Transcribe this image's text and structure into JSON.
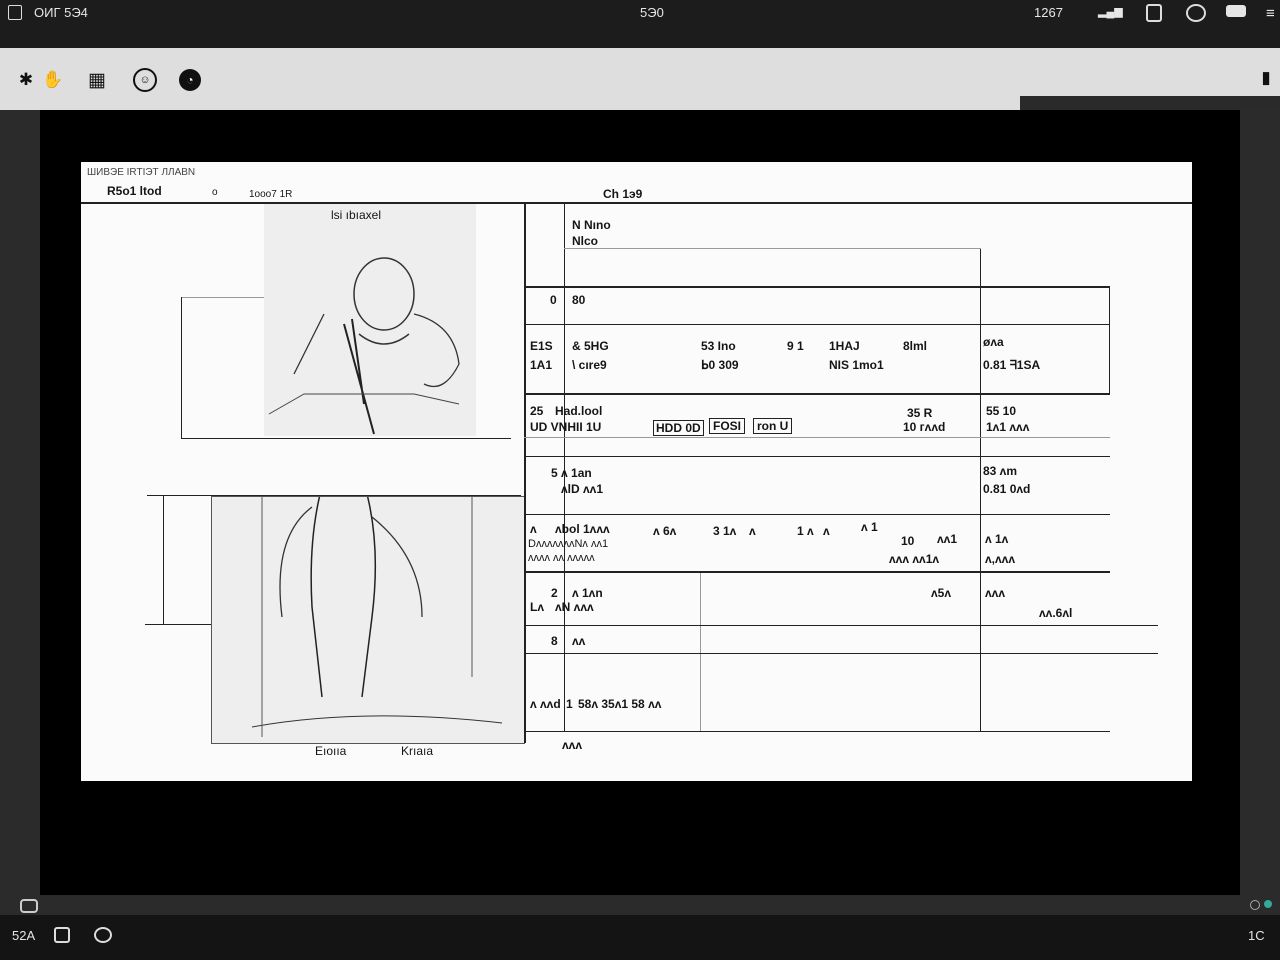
{
  "status_bar": {
    "app_label": "ОИГ 5Э4",
    "center_label": "5Э0",
    "time": "1267"
  },
  "toolbar": {
    "icons": [
      "asterisk-icon",
      "hand-icon",
      "grid-icon",
      "face-icon",
      "clock-icon",
      "book-icon"
    ]
  },
  "document": {
    "header": {
      "top_line": "ШИВЭЕ ІRTІЭТ ЛЛАВN",
      "left_label": "R5o1 ltod",
      "left_small": "o",
      "mid_small": "1ooo7 1R",
      "center_label": "Сh 1э9"
    },
    "sketch": {
      "caption_top": "lsi ıbıaxel",
      "caption_bottom_left": "Eıoııa",
      "caption_bottom_right": "Krıaıa"
    },
    "table_rows": [
      {
        "cells": [
          "N Nııo",
          "Nlco"
        ]
      },
      {
        "cells": [
          "0",
          "80"
        ]
      },
      {
        "cells": [
          "Ε1S2",
          "Ꮾ 5ΗG",
          "ᗺЗ 1ıııo",
          "ᖷ1",
          "1HAJ",
          "8lııl",
          "ølпі"
        ]
      },
      {
        "cells": [
          "1А1",
          "\\l cıreэ",
          "ᖯ0 ЗОЭ",
          "NIS 1ΓΠΟ",
          "0.Ъl ᖺlSA"
        ]
      },
      {
        "cells": [
          "2ᖷ",
          "Hadloo1",
          "UDVNHII 1U",
          "HDD 0D",
          "FOSI",
          "ᖷoıı U",
          "ᖷ3 ᖷ",
          "ᖷ1 ᖷᖷ1",
          "5ᖷ 1O",
          "1ᖷ1 ᖷ1ᖷ"
        ]
      },
      {
        "cells": [
          "5 ᖷ ᖷan",
          "ᖷID ᖷᖷᖷ",
          "8ᖷ 1ᖷᖷ",
          "0.ᖷ1 ᖷᖷᖷ"
        ]
      },
      {
        "cells": [
          "ᖷ",
          "ᖷᖷ1 1ᖷᖷᖷᖷ",
          "ᖷᖷᖷᖷᖷ",
          "5ᖷ ᖷ",
          "ᖷᖷᖷ",
          "ᖷᖷ",
          "ᖷᖷ ᖷ",
          "ᖷ1ᖷ",
          "ᖷᖷᖷᖷᖷᖷ",
          "ᖷ ᖷᖷᖷ",
          "ᖷᖷ ᖷᖷ"
        ]
      },
      {
        "cells": [
          "2",
          "ᖷ 1ᖷᖷᖷ",
          "ᖷᖷ ᖷᖷᖷᖷᖷ",
          "ᖷᖷᖷ ᖷ",
          "ᖷᖷᖷ",
          "ᖷᖷ.ᖷᖷᖷ"
        ]
      },
      {
        "cells": [
          "ᖷ",
          "ᖷᖷ"
        ]
      },
      {
        "cells": [
          "ᖷ ᖷᖷᖷ",
          "ᖷ",
          "ᖷᖷᖷ ᖷᖷᖷᖷ ᖷᖷ ᖷᖷᖷ"
        ]
      },
      {
        "cells": [
          "ᖷᖷᖷᖷ"
        ]
      }
    ],
    "row_lines": {
      "r1": [
        "N Nıno",
        "Nlco"
      ],
      "r2": [
        "0",
        "80"
      ],
      "r3a": [
        "Ε1S",
        "& 5HG",
        "53 Ino",
        "9 1",
        "1HAJ",
        "8lml",
        "øᴧa"
      ],
      "r3b": [
        "1A1",
        "\\ cıre9",
        "ᖯ0 309",
        "NIS 1mo1",
        "0.81 ᖷ1SA"
      ],
      "r4a": [
        "25",
        "Had.lool",
        "HDD 0D",
        "FOSI",
        "ron U",
        "35 R",
        "55 10"
      ],
      "r4b": [
        "UD VNHII 1U",
        "10 ᴦᴧᴧd",
        "1ᴧ1 ᴧᴧᴧ"
      ],
      "r5": [
        "5 ᴧ 1an",
        "ᴧlD ᴧᴧ1",
        "83 ᴧm",
        "0.81 0ᴧd"
      ],
      "r6a": [
        "ᴧ",
        "ᴧbol 1ᴧᴧᴧ",
        "ᴧ 6ᴧ",
        "3 1ᴧ",
        "ᴧ",
        "1 ᴧ",
        "ᴧ",
        "ᴧ 1",
        "10",
        "ᴧᴧ1",
        "ᴧ 1ᴧ"
      ],
      "r6b": [
        "DᴧᴧᴧᴧᴧᴧᴧNᴧ ᴧᴧ1",
        "ᴧᴧᴧᴧ ᴧᴧ ᴧᴧᴧᴧᴧ",
        "ᴧᴧᴧ ᴧᴧ1ᴧ",
        "ᴧ,ᴧᴧᴧ"
      ],
      "r7": [
        "2",
        "ᴧ 1ᴧn",
        "Lᴧ",
        "ᴧN ᴧᴧᴧ",
        "ᴧ5ᴧ",
        "ᴧᴧᴧ",
        "ᴧᴧ.6ᴧl"
      ],
      "r8": [
        "8",
        "ᴧᴧ"
      ],
      "r9": [
        "ᴧ ᴧᴧd",
        "1",
        "58ᴧ 35ᴧ1 58 ᴧᴧ"
      ],
      "r10": [
        "ᴧᴧᴧ"
      ]
    }
  },
  "bottom": {
    "bar_icon": "chat-icon",
    "taskbar_left": "52A",
    "taskbar_right": "1C"
  }
}
